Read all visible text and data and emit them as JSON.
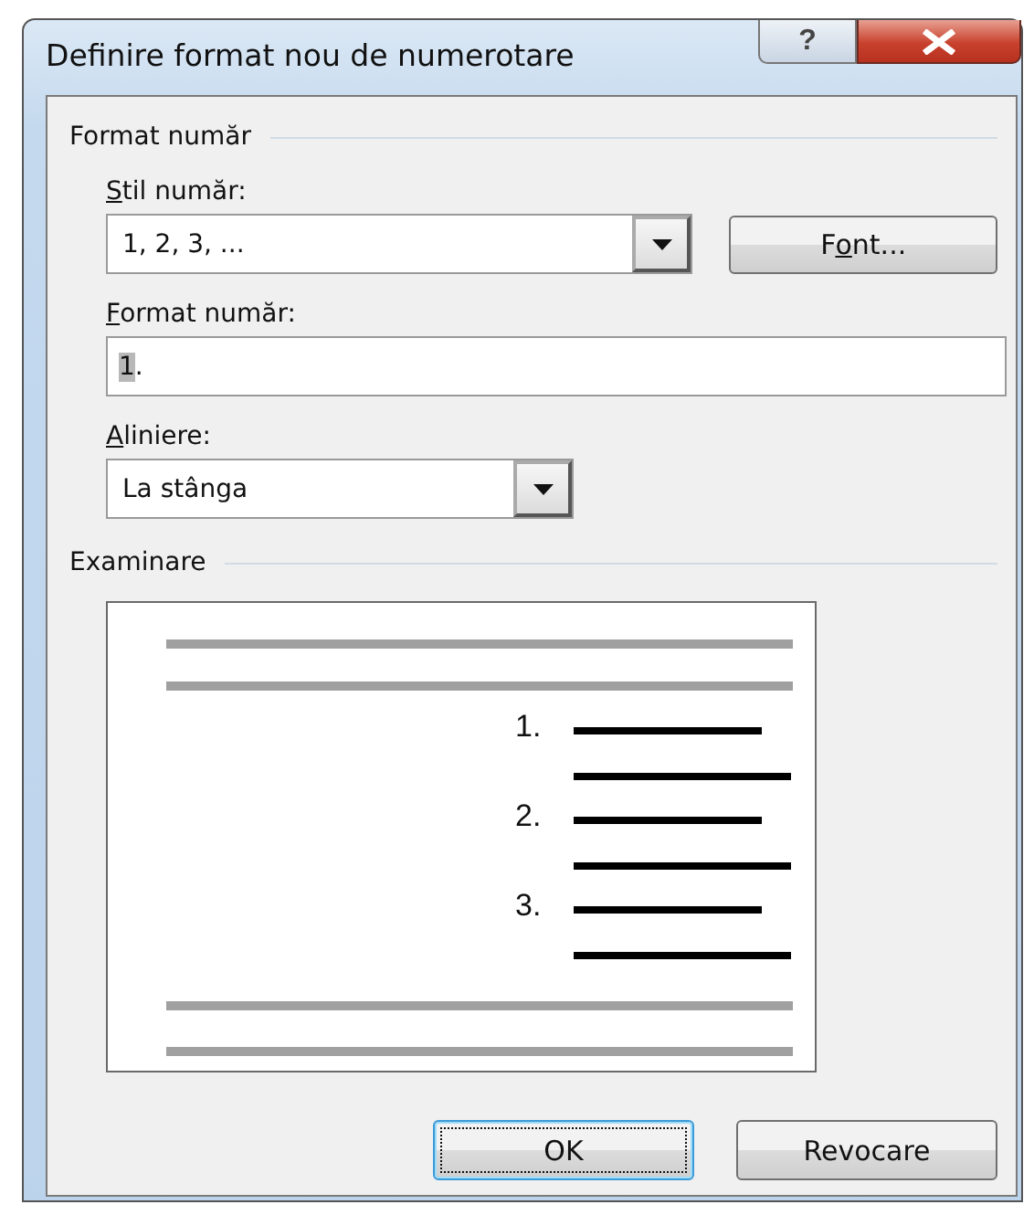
{
  "window": {
    "title": "Definire format nou de numerotare",
    "help_glyph": "?"
  },
  "format_group": {
    "title": "Format număr",
    "style_label": {
      "key": "S",
      "after": "til număr:"
    },
    "style_value": "1, 2, 3, ...",
    "font_button": {
      "before": "F",
      "key": "o",
      "after": "nt..."
    },
    "format_label": {
      "key": "F",
      "after": "ormat număr:"
    },
    "format_value": {
      "selected": "1",
      "rest": "."
    },
    "align_label": {
      "key": "A",
      "after": "liniere:"
    },
    "align_value": "La stânga"
  },
  "preview_group": {
    "title": "Examinare",
    "numbers": [
      "1.",
      "2.",
      "3."
    ]
  },
  "buttons": [
    {
      "label": "OK",
      "default": true
    },
    {
      "label": "Revocare",
      "default": false
    }
  ]
}
